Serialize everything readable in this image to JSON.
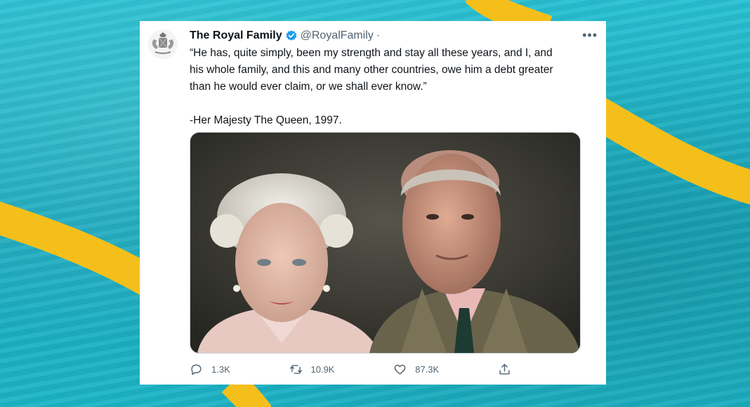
{
  "background": {
    "base_color": "#1fb6c8",
    "accent_color": "#f5bf1b"
  },
  "tweet": {
    "display_name": "The Royal Family",
    "handle": "@RoyalFamily",
    "separator": "·",
    "verified": true,
    "verified_color": "#1d9bf0",
    "more_icon": "more-horizontal-icon",
    "text": "“He has, quite simply, been my strength and stay all these years, and I, and\nhis whole family, and this and many other countries, owe him a debt greater\nthan he would ever claim, or we shall ever know.”\n\n-Her Majesty The Queen, 1997.",
    "media": {
      "subject": "portrait-photo-queen-and-prince"
    },
    "actions": {
      "reply_count": "1.3K",
      "retweet_count": "10.9K",
      "like_count": "87.3K",
      "reply_icon": "reply-icon",
      "retweet_icon": "retweet-icon",
      "like_icon": "heart-icon",
      "share_icon": "share-icon"
    }
  }
}
